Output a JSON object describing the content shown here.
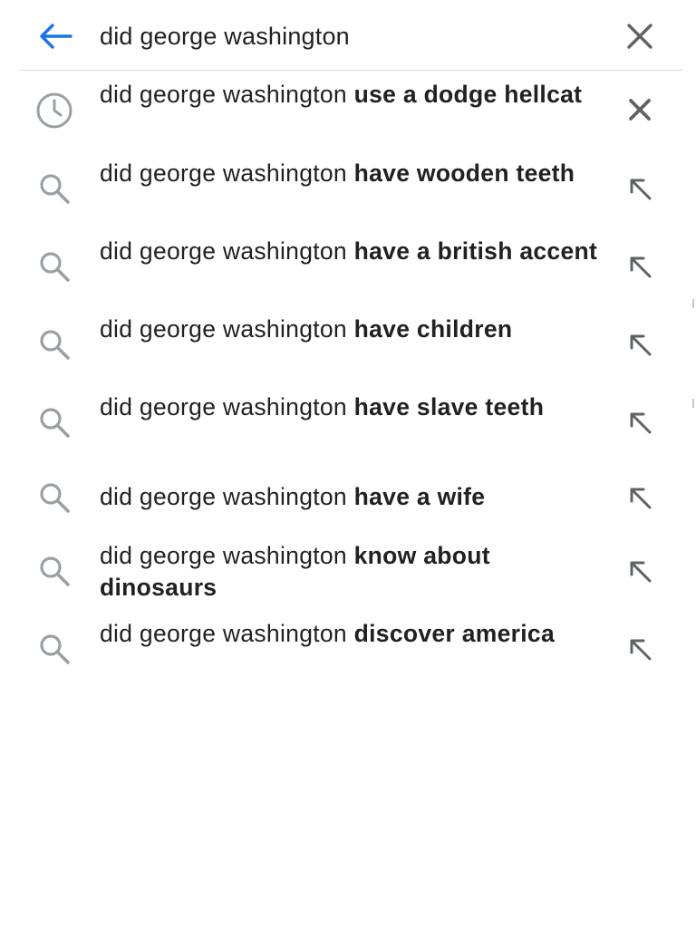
{
  "search": {
    "query": "did george washington",
    "back_icon": "arrow-left-icon",
    "clear_icon": "close-icon",
    "accent_color": "#1a73e8"
  },
  "suggestions": [
    {
      "type": "history",
      "prefix": "did george washington ",
      "completion": "use a dodge hellcat",
      "icon": "history-clock-icon",
      "action_icon": "remove-icon"
    },
    {
      "type": "search",
      "prefix": "did george washington ",
      "completion": "have wooden teeth",
      "icon": "search-icon",
      "action_icon": "fill-query-arrow-icon"
    },
    {
      "type": "search",
      "prefix": "did george washington ",
      "completion": "have a british accent",
      "icon": "search-icon",
      "action_icon": "fill-query-arrow-icon"
    },
    {
      "type": "search",
      "prefix": "did george washington ",
      "completion": "have children",
      "icon": "search-icon",
      "action_icon": "fill-query-arrow-icon"
    },
    {
      "type": "search",
      "prefix": "did george washington ",
      "completion": "have slave teeth",
      "icon": "search-icon",
      "action_icon": "fill-query-arrow-icon"
    },
    {
      "type": "search",
      "prefix": "did george washington ",
      "completion": "have a wife",
      "icon": "search-icon",
      "action_icon": "fill-query-arrow-icon"
    },
    {
      "type": "search",
      "prefix": "did george washington ",
      "completion": "know about dinosaurs",
      "icon": "search-icon",
      "action_icon": "fill-query-arrow-icon"
    },
    {
      "type": "search",
      "prefix": "did george washington ",
      "completion": "discover america",
      "icon": "search-icon",
      "action_icon": "fill-query-arrow-icon"
    }
  ]
}
